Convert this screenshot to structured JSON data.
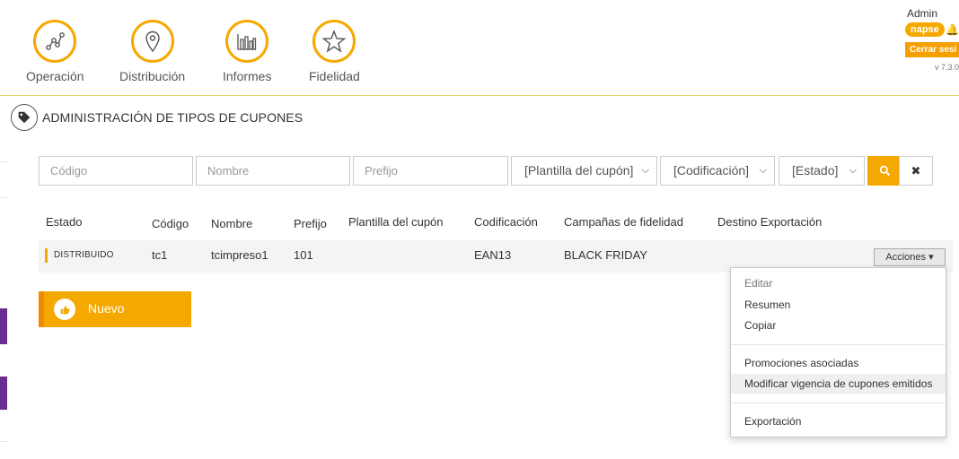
{
  "nav": {
    "items": [
      {
        "label": "Operación",
        "icon": "graph-nodes-icon"
      },
      {
        "label": "Distribución",
        "icon": "map-pin-icon"
      },
      {
        "label": "Informes",
        "icon": "bar-chart-icon"
      },
      {
        "label": "Fidelidad",
        "icon": "star-icon"
      }
    ]
  },
  "user": {
    "name": "Admin",
    "badge": "napse",
    "logout_label": "Cerrar sesi",
    "version": "v 7.3.0"
  },
  "page": {
    "title": "ADMINISTRACIÓN DE TIPOS DE CUPONES",
    "title_icon": "tag-icon"
  },
  "filters": {
    "codigo_placeholder": "Código",
    "nombre_placeholder": "Nombre",
    "prefijo_placeholder": "Prefijo",
    "plantilla_value": "[Plantilla del cupón]",
    "codificacion_value": "[Codificación]",
    "estado_value": "[Estado]"
  },
  "table": {
    "headers": [
      "Estado",
      "Código",
      "Nombre",
      "Prefijo",
      "Plantilla del cupón",
      "Codificación",
      "Campañas de fidelidad",
      "Destino Exportación"
    ],
    "rows": [
      {
        "estado": "DISTRIBUIDO",
        "codigo": "tc1",
        "nombre": "tcimpreso1",
        "prefijo": "101",
        "plantilla": "",
        "codificacion": "EAN13",
        "campanas": "BLACK FRIDAY",
        "destino": "",
        "acciones_label": "Acciones"
      }
    ]
  },
  "nuevo_button": {
    "label": "Nuevo"
  },
  "actions_menu": {
    "items": [
      "Editar",
      "Resumen",
      "Copiar",
      "Promociones asociadas",
      "Modificar vigencia de cupones emitidos",
      "Exportación"
    ]
  },
  "colors": {
    "accent": "#f5a800",
    "nav_divider": "#e8d36a",
    "side_mark": "#6b2c91"
  }
}
